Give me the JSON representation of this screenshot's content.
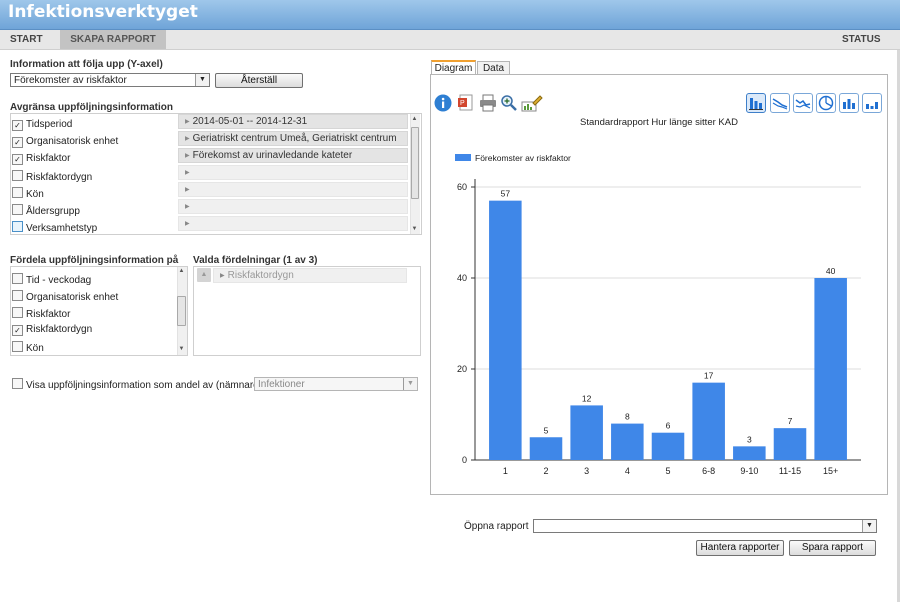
{
  "app": {
    "title": "Infektionsverktyget"
  },
  "nav": {
    "tabs": [
      {
        "label": "START"
      },
      {
        "label": "SKAPA RAPPORT",
        "active": true
      }
    ],
    "status": "STATUS"
  },
  "yaxis": {
    "heading": "Information att följa upp (Y-axel)",
    "selected": "Förekomster av riskfaktor",
    "reset_label": "Återställ"
  },
  "limit": {
    "heading": "Avgränsa uppföljningsinformation",
    "items": [
      {
        "label": "Tidsperiod",
        "checked": true,
        "value": "2014-05-01 -- 2014-12-31"
      },
      {
        "label": "Organisatorisk enhet",
        "checked": true,
        "value": "Geriatriskt centrum Umeå, Geriatriskt centrum"
      },
      {
        "label": "Riskfaktor",
        "checked": true,
        "value": "Förekomst av urinavledande kateter"
      },
      {
        "label": "Riskfaktordygn",
        "checked": false,
        "value": ""
      },
      {
        "label": "Kön",
        "checked": false,
        "value": ""
      },
      {
        "label": "Åldersgrupp",
        "checked": false,
        "value": ""
      },
      {
        "label": "Verksamhetstyp",
        "checked": false,
        "value": ""
      }
    ]
  },
  "distribute": {
    "heading": "Fördela uppföljningsinformation på",
    "items": [
      {
        "label": "Tid - veckodag",
        "checked": false
      },
      {
        "label": "Organisatorisk enhet",
        "checked": false
      },
      {
        "label": "Riskfaktor",
        "checked": false
      },
      {
        "label": "Riskfaktordygn",
        "checked": true
      },
      {
        "label": "Kön",
        "checked": false
      }
    ]
  },
  "selected_dist": {
    "heading": "Valda fördelningar (1 av 3)",
    "items": [
      {
        "label": "Riskfaktordygn"
      }
    ]
  },
  "share": {
    "label": "Visa uppföljningsinformation som andel av (nämnare)",
    "checked": false,
    "value": "Infektioner"
  },
  "chart_tabs": [
    {
      "label": "Diagram",
      "active": true
    },
    {
      "label": "Data",
      "active": false
    }
  ],
  "toolbar": {
    "tools": [
      {
        "icon": "info-icon"
      },
      {
        "icon": "powerpoint-export-icon"
      },
      {
        "icon": "print-icon"
      },
      {
        "icon": "zoom-icon"
      },
      {
        "icon": "edit-chart-icon"
      }
    ],
    "chart_types": [
      {
        "icon": "bar-chart-type-icon",
        "active": true
      },
      {
        "icon": "line-chart-type-icon",
        "active": false
      },
      {
        "icon": "area-chart-type-icon",
        "active": false
      },
      {
        "icon": "pie-chart-type-icon",
        "active": false
      },
      {
        "icon": "grouped-bar-chart-type-icon",
        "active": false
      },
      {
        "icon": "stacked-bar-chart-type-icon",
        "active": false
      }
    ]
  },
  "chart_data": {
    "type": "bar",
    "title": "Standardrapport Hur länge sitter KAD",
    "categories": [
      "1",
      "2",
      "3",
      "4",
      "5",
      "6-8",
      "9-10",
      "11-15",
      "15+"
    ],
    "series": [
      {
        "name": "Förekomster av riskfaktor",
        "values": [
          57,
          5,
          12,
          8,
          6,
          17,
          3,
          7,
          40
        ],
        "color": "#3f87e8"
      }
    ],
    "ylim": [
      0,
      60
    ],
    "yticks": [
      0,
      20,
      40,
      60
    ],
    "grid": true,
    "legend": "top-left",
    "data_labels": true
  },
  "report": {
    "open_label": "Öppna rapport",
    "open_value": "",
    "manage_label": "Hantera rapporter",
    "save_label": "Spara rapport"
  },
  "colors": {
    "header": "#7fb2e0",
    "bar": "#3f87e8",
    "active_tab": "#f0a030"
  }
}
